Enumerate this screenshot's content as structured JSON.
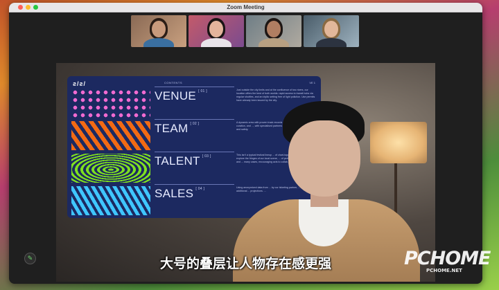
{
  "window": {
    "title": "Zoom Meeting"
  },
  "participants": [
    {
      "name": "participant-1"
    },
    {
      "name": "participant-2"
    },
    {
      "name": "participant-3"
    },
    {
      "name": "participant-4"
    }
  ],
  "slide": {
    "logo": "ƨ/ƨ/",
    "contents_label": "CONTENTS",
    "volume_label": "VE 1",
    "rows": [
      {
        "label": "VENUE",
        "num": "[ 01 ]",
        "desc": "Just outside the city limits and at the confluence of two rivers, our location offers the best of both worlds: rapid access to transit hubs via regular shuttles, and an idyllic setting free of light pollution. Use permits have already been issued by the city."
      },
      {
        "label": "TEAM",
        "num": "[ 02 ]",
        "desc": "A dynamic crew with proven track records in production, cultural curation, and ..., with specialised partners to tackle ticketing, ... health and safety."
      },
      {
        "label": "TALENT",
        "num": "[ 03 ]",
        "desc": "This isn't a typical festival lineup ... of chart-toppers. Our curatorial ... explore the fringes of our local scene, ... of performers spanning genres and ... many cases, encouraging acts to collab... one-off performances."
      },
      {
        "label": "SALES",
        "num": "[ 04 ]",
        "desc": "Using anonymized data from ... by our ticketing partner, ... without any additional ... projections. ..."
      }
    ]
  },
  "subtitle": "大号的叠层让人物存在感更强",
  "watermark": {
    "brand": "PCHOME",
    "url": "PCHOME.NET"
  },
  "colors": {
    "slide_bg": "#1c2960",
    "pattern_pink": "#f06ad0",
    "pattern_orange": "#f26a14",
    "pattern_green": "#7fe020",
    "pattern_blue": "#3fc6ff"
  }
}
